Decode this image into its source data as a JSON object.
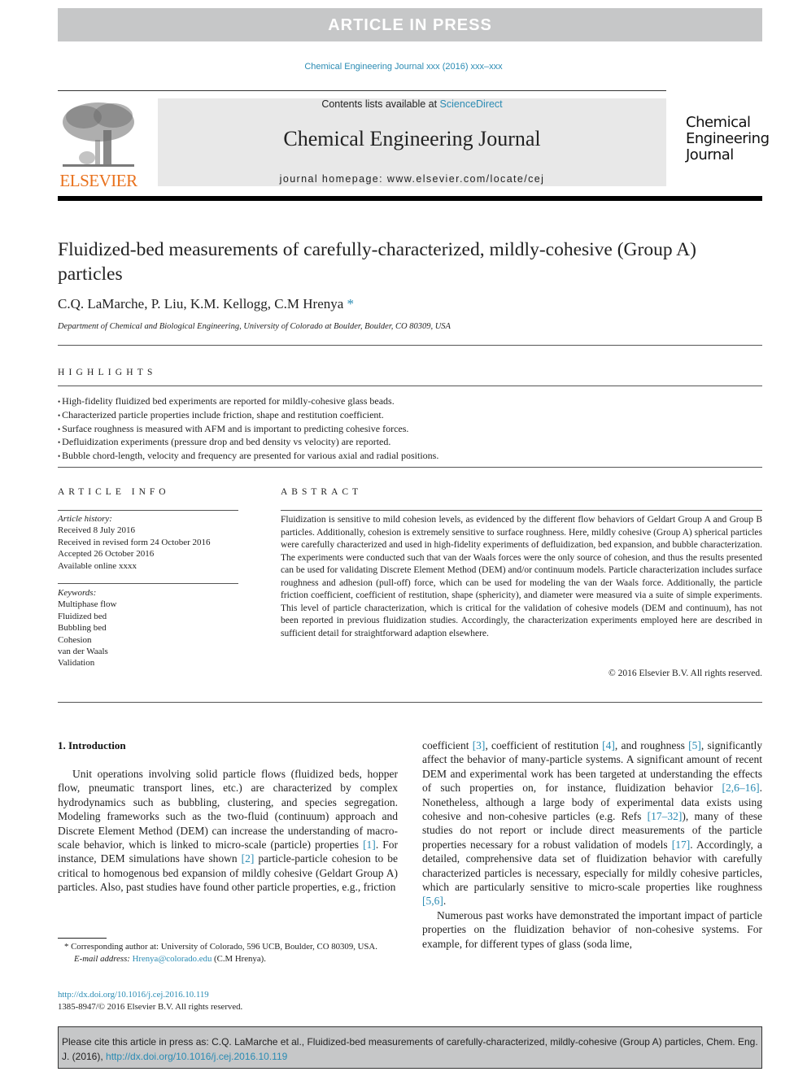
{
  "banner": {
    "label": "ARTICLE IN PRESS"
  },
  "journal_ref": "Chemical Engineering Journal xxx (2016) xxx–xxx",
  "header": {
    "publisher_logo_text": "ELSEVIER",
    "contents_prefix": "Contents lists available at ",
    "contents_link": "ScienceDirect",
    "journal_name": "Chemical Engineering Journal",
    "homepage_prefix": "journal homepage: ",
    "homepage_url": "www.elsevier.com/locate/cej",
    "journal_logo_lines": [
      "Chemical",
      "Engineering",
      "Journal"
    ]
  },
  "article": {
    "title": "Fluidized-bed measurements of carefully-characterized, mildly-cohesive (Group A) particles",
    "authors": "C.Q. LaMarche, P. Liu, K.M. Kellogg, C.M Hrenya",
    "corresponding_mark": "*",
    "affiliation": "Department of Chemical and Biological Engineering, University of Colorado at Boulder, Boulder, CO 80309, USA"
  },
  "highlights": {
    "heading": "HIGHLIGHTS",
    "items": [
      "High-fidelity fluidized bed experiments are reported for mildly-cohesive glass beads.",
      "Characterized particle properties include friction, shape and restitution coefficient.",
      "Surface roughness is measured with AFM and is important to predicting cohesive forces.",
      "Defluidization experiments (pressure drop and bed density vs velocity) are reported.",
      "Bubble chord-length, velocity and frequency are presented for various axial and radial positions."
    ]
  },
  "article_info": {
    "heading": "ARTICLE INFO",
    "history_label": "Article history:",
    "history": [
      "Received 8 July 2016",
      "Received in revised form 24 October 2016",
      "Accepted 26 October 2016",
      "Available online xxxx"
    ],
    "keywords_label": "Keywords:",
    "keywords": [
      "Multiphase flow",
      "Fluidized bed",
      "Bubbling bed",
      "Cohesion",
      "van der Waals",
      "Validation"
    ]
  },
  "abstract": {
    "heading": "ABSTRACT",
    "text": "Fluidization is sensitive to mild cohesion levels, as evidenced by the different flow behaviors of Geldart Group A and Group B particles. Additionally, cohesion is extremely sensitive to surface roughness. Here, mildly cohesive (Group A) spherical particles were carefully characterized and used in high-fidelity experiments of defluidization, bed expansion, and bubble characterization. The experiments were conducted such that van der Waals forces were the only source of cohesion, and thus the results presented can be used for validating Discrete Element Method (DEM) and/or continuum models. Particle characterization includes surface roughness and adhesion (pull-off) force, which can be used for modeling the van der Waals force. Additionally, the particle friction coefficient, coefficient of restitution, shape (sphericity), and diameter were measured via a suite of simple experiments. This level of particle characterization, which is critical for the validation of cohesive models (DEM and continuum), has not been reported in previous fluidization studies. Accordingly, the characterization experiments employed here are described in sufficient detail for straightforward adaption elsewhere.",
    "copyright": "© 2016 Elsevier B.V. All rights reserved."
  },
  "introduction": {
    "heading": "1. Introduction",
    "col1": {
      "p1_a": "Unit operations involving solid particle flows (fluidized beds, hopper flow, pneumatic transport lines, etc.) are characterized by complex hydrodynamics such as bubbling, clustering, and species segregation. Modeling frameworks such as the two-fluid (continuum) approach and Discrete Element Method (DEM) can increase the understanding of macro-scale behavior, which is linked to micro-scale (particle) properties ",
      "ref1": "[1]",
      "p1_b": ". For instance, DEM simulations have shown ",
      "ref2": "[2]",
      "p1_c": " particle-particle cohesion to be critical to homogenous bed expansion of mildly cohesive (Geldart Group A) particles. Also, past studies have found other particle properties, e.g., friction"
    },
    "col2": {
      "a": "coefficient ",
      "ref3": "[3]",
      "b": ", coefficient of restitution ",
      "ref4": "[4]",
      "c": ", and roughness ",
      "ref5": "[5]",
      "d": ", significantly affect the behavior of many-particle systems. A significant amount of recent DEM and experimental work has been targeted at understanding the effects of such properties on, for instance, fluidization behavior ",
      "ref6": "[2,6–16]",
      "e": ". Nonetheless, although a large body of experimental data exists using cohesive and non-cohesive particles (e.g. Refs ",
      "ref7": "[17–32]",
      "f": "), many of these studies do not report or include direct measurements of the particle properties necessary for a robust validation of models ",
      "ref8": "[17]",
      "g": ". Accordingly, a detailed, comprehensive data set of fluidization behavior with carefully characterized particles is necessary, especially for mildly cohesive particles, which are particularly sensitive to micro-scale properties like roughness ",
      "ref9": "[5,6]",
      "h": ".",
      "p2": "Numerous past works have demonstrated the important impact of particle properties on the fluidization behavior of non-cohesive systems. For example, for different types of glass (soda lime,"
    }
  },
  "footnote": {
    "corresponding": "* Corresponding author at: University of Colorado, 596 UCB, Boulder, CO 80309, USA.",
    "email_label": "E-mail address: ",
    "email": "Hrenya@colorado.edu",
    "email_suffix": " (C.M Hrenya)."
  },
  "doi": {
    "url": "http://dx.doi.org/10.1016/j.cej.2016.10.119",
    "issn_copyright": "1385-8947/© 2016 Elsevier B.V. All rights reserved."
  },
  "citation_box": {
    "text": "Please cite this article in press as: C.Q. LaMarche et al., Fluidized-bed measurements of carefully-characterized, mildly-cohesive (Group A) particles, Chem. Eng. J. (2016), ",
    "link": "http://dx.doi.org/10.1016/j.cej.2016.10.119"
  },
  "colors": {
    "link": "#2a8bb3",
    "elsevier_orange": "#e9711c",
    "banner_gray": "#c6c7c8",
    "header_box": "#e8e8e8"
  }
}
